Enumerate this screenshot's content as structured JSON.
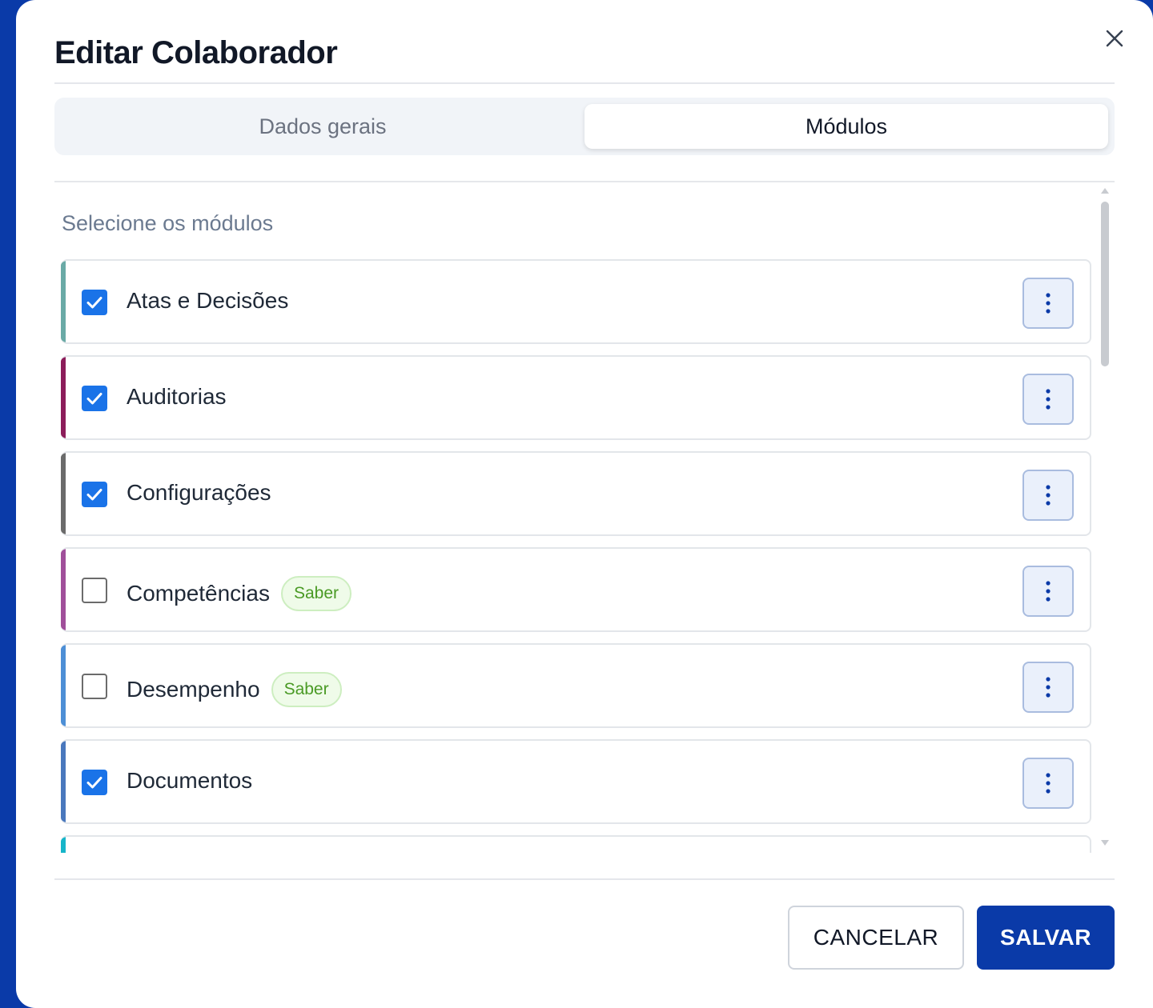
{
  "dialog": {
    "title": "Editar Colaborador"
  },
  "tabs": [
    {
      "label": "Dados gerais",
      "active": false
    },
    {
      "label": "Módulos",
      "active": true
    }
  ],
  "modules_section": {
    "label": "Selecione os módulos",
    "items": [
      {
        "name": "Atas e Decisões",
        "checked": true,
        "accent": "#6aaaa6",
        "badge": ""
      },
      {
        "name": "Auditorias",
        "checked": true,
        "accent": "#8c1d5a",
        "badge": ""
      },
      {
        "name": "Configurações",
        "checked": true,
        "accent": "#6b6b6b",
        "badge": ""
      },
      {
        "name": "Competências",
        "checked": false,
        "accent": "#a04f9a",
        "badge": "Saber"
      },
      {
        "name": "Desempenho",
        "checked": false,
        "accent": "#4d8fd6",
        "badge": "Saber"
      },
      {
        "name": "Documentos",
        "checked": true,
        "accent": "#4a78bd",
        "badge": ""
      },
      {
        "name": "",
        "checked": false,
        "accent": "#17b5c9",
        "badge": ""
      }
    ]
  },
  "footer": {
    "cancel_label": "CANCELAR",
    "save_label": "SALVAR"
  },
  "colors": {
    "primary": "#0a3aa8",
    "checkbox": "#1a73e8",
    "badge_text": "#4a9a25"
  }
}
